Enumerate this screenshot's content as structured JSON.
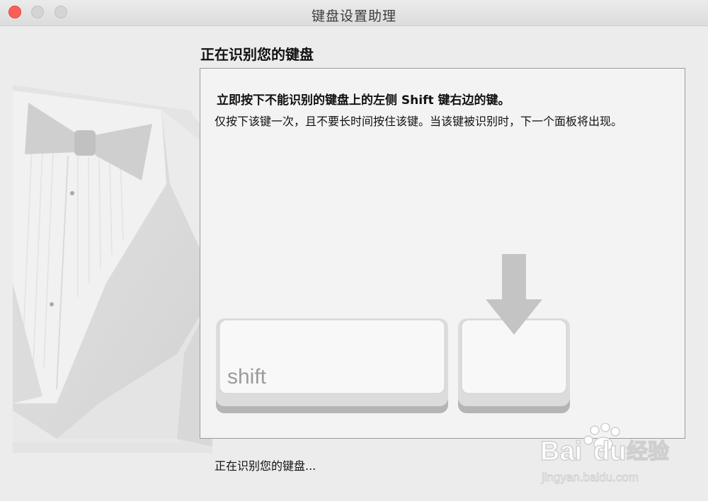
{
  "window": {
    "title": "键盘设置助理"
  },
  "titlebar": {
    "buttons": {
      "close": "close-button",
      "minimize": "minimize-button",
      "zoom": "zoom-button"
    }
  },
  "main": {
    "heading": "正在识别您的键盘",
    "instruction": "立即按下不能识别的键盘上的左侧 Shift 键右边的键。",
    "detail": "仅按下该键一次，且不要长时间按住该键。当该键被识别时，下一个面板将出现。",
    "shift_key_label": "shift",
    "status": "正在识别您的键盘..."
  },
  "watermark": {
    "brand": "Bai du 经验",
    "url": "jingyan.baidu.com"
  },
  "colors": {
    "close": "#fc5f57",
    "inactive_traffic": "#d4d4d4",
    "window_bg": "#ececec",
    "panel_bg": "#f3f3f3",
    "arrow": "#c4c4c4"
  }
}
